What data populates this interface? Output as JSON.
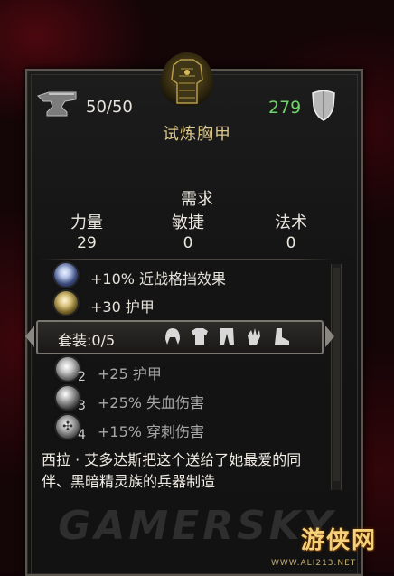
{
  "item": {
    "durability": "50/50",
    "gold": "279",
    "name": "试炼胸甲"
  },
  "requirements": {
    "title": "需求",
    "stats": [
      {
        "label": "力量",
        "value": "29"
      },
      {
        "label": "敏捷",
        "value": "0"
      },
      {
        "label": "法术",
        "value": "0"
      }
    ]
  },
  "modifiers": [
    {
      "text": "+10% 近战格挡效果",
      "icon": "blue-orb-icon"
    },
    {
      "text": "+30 护甲",
      "icon": "gold-orb-icon"
    }
  ],
  "set": {
    "label": "套装:0/5",
    "piece_icons": [
      "helmet-icon",
      "chest-armor-icon",
      "leggings-icon",
      "gloves-icon",
      "boots-icon"
    ],
    "bonuses": [
      {
        "count": "2",
        "text": "+25 护甲"
      },
      {
        "count": "3",
        "text": "+25% 失血伤害"
      },
      {
        "count": "4",
        "text": "+15% 穿刺伤害"
      }
    ]
  },
  "description": "西拉 · 艾多达斯把这个送给了她最爱的同伴、黑暗精灵族的兵器制造",
  "watermark": "GAMERSKY",
  "logo": {
    "text": "游侠网",
    "url": "WWW.ALI213.NET"
  },
  "colors": {
    "gold_text": "#6fd36a",
    "item_name": "#d9c68a"
  }
}
